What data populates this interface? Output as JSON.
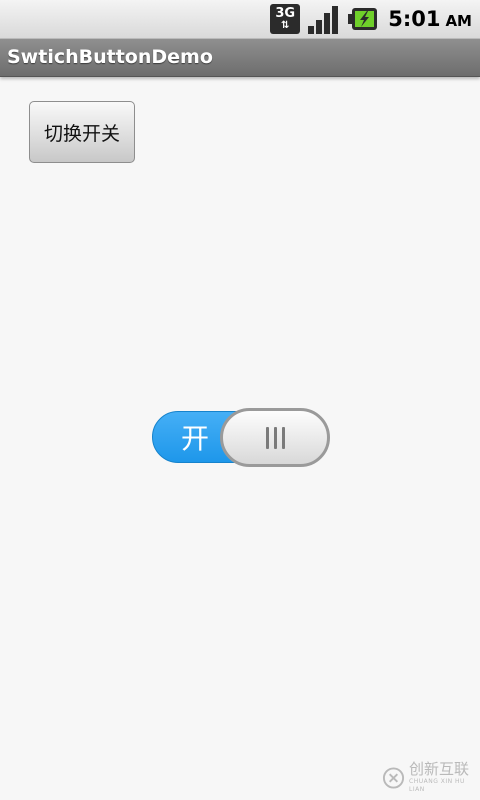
{
  "status_bar": {
    "network_label": "3G",
    "time": "5:01",
    "ampm": "AM",
    "icons": [
      "network-3g-icon",
      "signal-strength-icon",
      "battery-charging-icon"
    ],
    "battery_color": "#6fcf2a"
  },
  "app": {
    "title": "SwtichButtonDemo"
  },
  "toggle_button": {
    "label": "切换开关"
  },
  "switch": {
    "state_label": "开",
    "is_on": true,
    "on_color": "#2b9ef0"
  },
  "watermark": {
    "text": "创新互联",
    "subtext": "CHUANG XIN HU LIAN"
  }
}
